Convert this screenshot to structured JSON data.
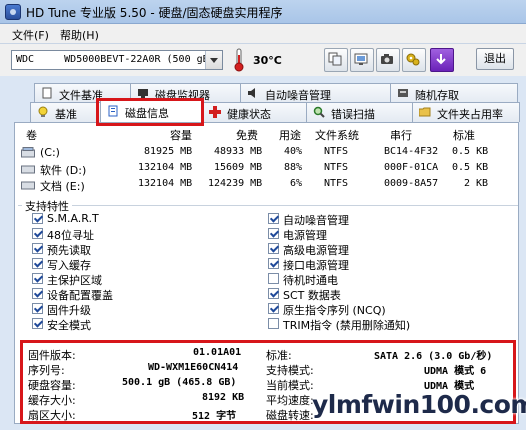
{
  "window": {
    "title": "HD Tune 专业版 5.50 - 硬盘/固态硬盘实用程序"
  },
  "menu": {
    "items": [
      "文件(F)",
      "帮助(H)"
    ]
  },
  "toolbar": {
    "drive": "WDC     WD5000BEVT-22A0R (500 gB)",
    "temperature": "30°C",
    "exit_label": "退出",
    "icons": [
      "copy-icon",
      "screenshot-icon",
      "camera-icon",
      "settings-icon",
      "download-icon"
    ]
  },
  "tabs": {
    "row1": [
      "文件基准",
      "磁盘监视器",
      "自动噪音管理",
      "随机存取"
    ],
    "row2": [
      "基准",
      "磁盘信息",
      "健康状态",
      "错误扫描",
      "文件夹占用率"
    ],
    "active": "磁盘信息"
  },
  "volumes": {
    "headers": [
      "卷",
      "容量",
      "免费",
      "用途",
      "文件系统",
      "串行",
      "标准"
    ],
    "rows": [
      {
        "name": "(C:)",
        "capacity": "81925 MB",
        "free": "48933 MB",
        "usage": "40%",
        "fs": "NTFS",
        "serial": "BC14-4F32",
        "block": "0.5 KB"
      },
      {
        "name": "软件 (D:)",
        "capacity": "132104 MB",
        "free": "15609 MB",
        "usage": "88%",
        "fs": "NTFS",
        "serial": "000F-01CA",
        "block": "0.5 KB"
      },
      {
        "name": "文档 (E:)",
        "capacity": "132104 MB",
        "free": "124239 MB",
        "usage": "6%",
        "fs": "NTFS",
        "serial": "0009-8A57",
        "block": "2 KB"
      }
    ]
  },
  "features": {
    "title": "支持特性",
    "left": [
      {
        "label": "S.M.A.R.T",
        "checked": true
      },
      {
        "label": "48位寻址",
        "checked": true
      },
      {
        "label": "预先读取",
        "checked": true
      },
      {
        "label": "写入缓存",
        "checked": true
      },
      {
        "label": "主保护区域",
        "checked": true
      },
      {
        "label": "设备配置覆盖",
        "checked": true
      },
      {
        "label": "固件升级",
        "checked": true
      },
      {
        "label": "安全模式",
        "checked": true
      }
    ],
    "right": [
      {
        "label": "自动噪音管理",
        "checked": true
      },
      {
        "label": "电源管理",
        "checked": true
      },
      {
        "label": "高级电源管理",
        "checked": true
      },
      {
        "label": "接口电源管理",
        "checked": true
      },
      {
        "label": "待机时通电",
        "checked": false
      },
      {
        "label": "SCT 数据表",
        "checked": true
      },
      {
        "label": "原生指令序列 (NCQ)",
        "checked": true
      },
      {
        "label": "TRIM指令 (禁用删除通知)",
        "checked": false
      }
    ]
  },
  "info": {
    "left": [
      {
        "label": "固件版本:",
        "value": "01.01A01"
      },
      {
        "label": "序列号:",
        "value": "WD-WXM1E60CN414"
      },
      {
        "label": "硬盘容量:",
        "value": "500.1 gB (465.8 GB)"
      },
      {
        "label": "缓存大小:",
        "value": "8192 KB"
      },
      {
        "label": "扇区大小:",
        "value": "512 字节"
      }
    ],
    "right": [
      {
        "label": "标准:",
        "value": "SATA 2.6 (3.0 Gb/秒)"
      },
      {
        "label": "支持模式:",
        "value": "UDMA 模式 6"
      },
      {
        "label": "当前模式:",
        "value": "UDMA 模式"
      },
      {
        "label": "平均速度:",
        "value": ""
      },
      {
        "label": "磁盘转速:",
        "value": ""
      }
    ]
  },
  "watermark": {
    "text": "ylmfwin100.com"
  },
  "colors": {
    "highlight": "#d7161a",
    "accent": "#204a9a"
  }
}
